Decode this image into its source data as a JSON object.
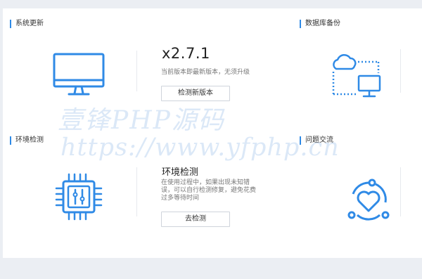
{
  "system_update": {
    "title": "系统更新",
    "version": "x2.7.1",
    "status": "当前版本即最新版本，无须升级",
    "check_button": "检测新版本"
  },
  "database_backup": {
    "title": "数据库备份"
  },
  "env_check": {
    "title": "环境检测",
    "heading": "环境检测",
    "description_line1": "在使用过程中，如果出现未知错",
    "description_line2": "误，可以自行检测修复，避免花费",
    "description_line3": "过多等待时间",
    "check_button": "去检测"
  },
  "feedback": {
    "title": "问题交流"
  },
  "watermark": {
    "line1": "壹锋PHP源码",
    "line2": "https://www.yfphp.cn"
  },
  "colors": {
    "accent": "#2f8ae6"
  }
}
